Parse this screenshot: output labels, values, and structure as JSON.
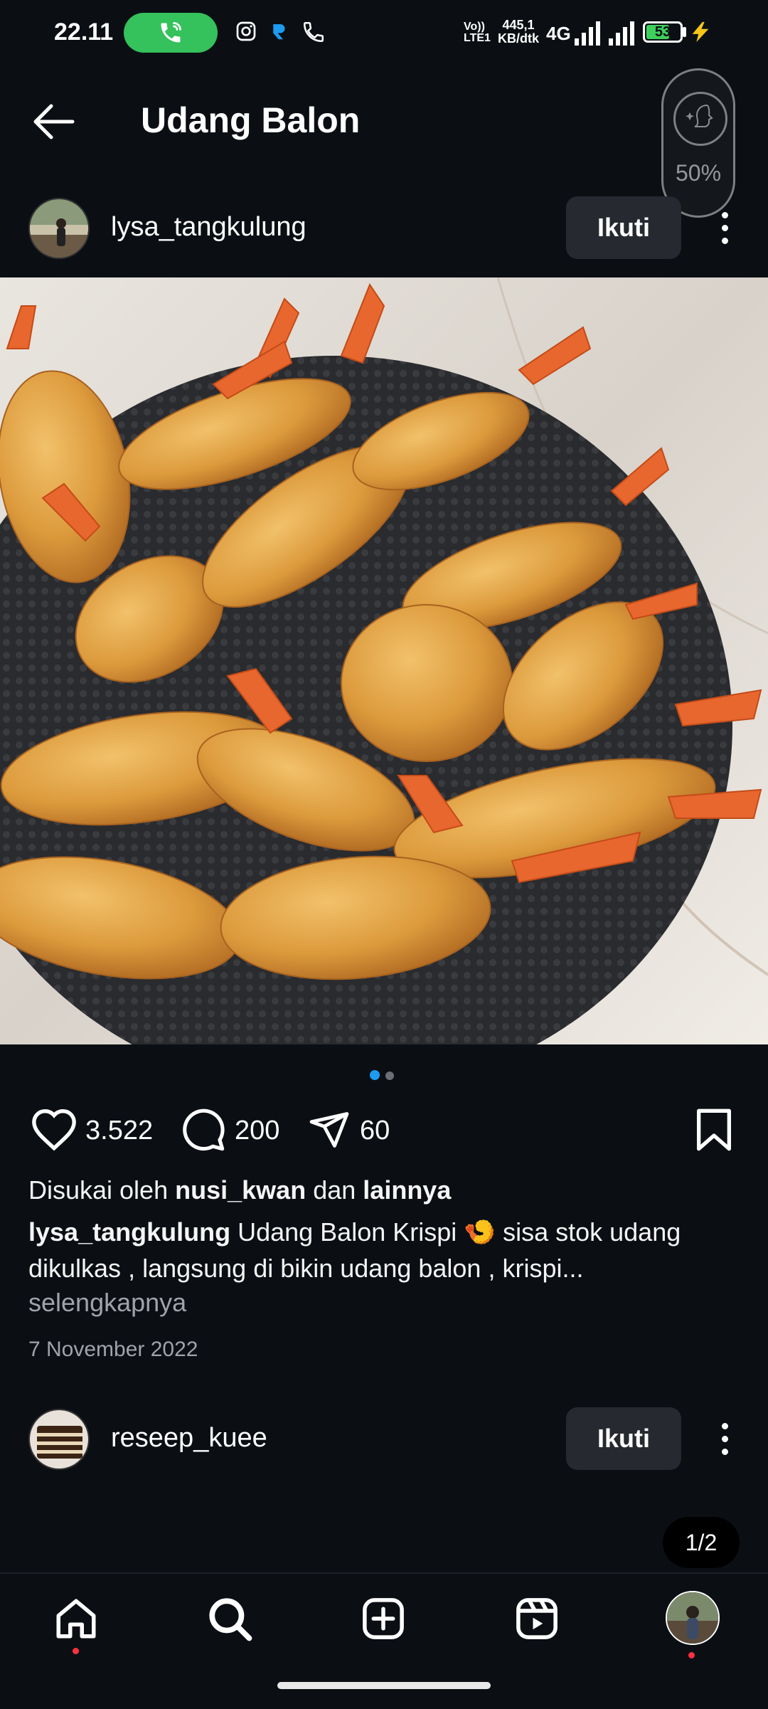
{
  "status_bar": {
    "time": "22.11",
    "volte": "Vo)) LTE1",
    "net_speed_value": "445,1",
    "net_speed_unit": "KB/dtk",
    "network": "4G",
    "battery": "53"
  },
  "header": {
    "title": "Udang Balon",
    "beauty_level": "50%"
  },
  "post": {
    "username": "lysa_tangkulung",
    "follow_label": "Ikuti",
    "likes": "3.522",
    "comments": "200",
    "shares": "60",
    "carousel_position": 0,
    "carousel_count": 2,
    "liked_by_prefix": "Disukai oleh",
    "liked_by_user": "nusi_kwan",
    "liked_by_conj": "dan",
    "liked_by_others": "lainnya",
    "caption_user": "lysa_tangkulung",
    "caption_text_1": "Udang Balon Krispi 🍤 sisa stok udang",
    "caption_text_2": "dikulkas , langsung di bikin udang balon , krispi...",
    "more_label": "selengkapnya",
    "date": "7 November 2022"
  },
  "next_post": {
    "username": "reseep_kuee",
    "follow_label": "Ikuti"
  },
  "pager": "1/2",
  "nav": {
    "items": [
      "home-icon",
      "search-icon",
      "create-icon",
      "reels-icon",
      "profile-avatar"
    ]
  },
  "colors": {
    "background": "#0b0f14",
    "accent_blue": "#1d9bf0",
    "call_green": "#35c15b",
    "notification_red": "#ff3040"
  }
}
